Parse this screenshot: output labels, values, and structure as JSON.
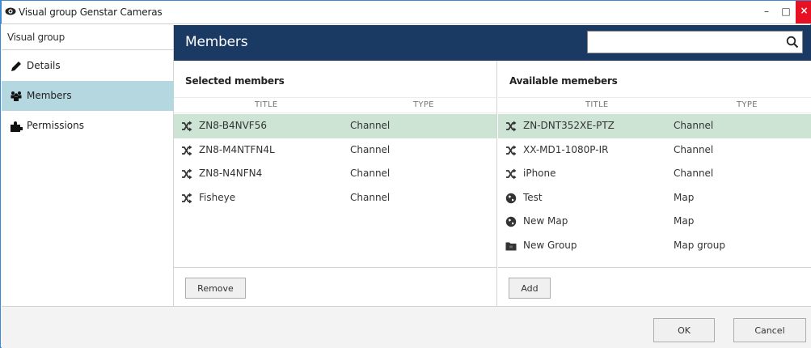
{
  "window": {
    "title": "Visual group Genstar Cameras",
    "app_icon": "eye-icon",
    "min_label": "–",
    "max_label": "□",
    "close_label": "×"
  },
  "sidebar": {
    "header": "Visual group",
    "items": [
      {
        "label": "Details",
        "icon": "pencil-icon",
        "active": false
      },
      {
        "label": "Members",
        "icon": "members-icon",
        "active": true
      },
      {
        "label": "Permissions",
        "icon": "puzzle-icon",
        "active": false
      }
    ]
  },
  "header": {
    "title": "Members",
    "search_placeholder": "",
    "search_icon": "search-icon"
  },
  "selected": {
    "title": "Selected members",
    "columns": [
      "TITLE",
      "TYPE"
    ],
    "rows": [
      {
        "title": "ZN8-B4NVF56",
        "type": "Channel",
        "icon": "shuffle-icon",
        "selected": true
      },
      {
        "title": "ZN8-M4NTFN4L",
        "type": "Channel",
        "icon": "shuffle-icon",
        "selected": false
      },
      {
        "title": "ZN8-N4NFN4",
        "type": "Channel",
        "icon": "shuffle-icon",
        "selected": false
      },
      {
        "title": "Fisheye",
        "type": "Channel",
        "icon": "shuffle-icon",
        "selected": false
      }
    ],
    "button": "Remove"
  },
  "available": {
    "title": "Available memebers",
    "columns": [
      "TITLE",
      "TYPE"
    ],
    "rows": [
      {
        "title": "ZN-DNT352XE-PTZ",
        "type": "Channel",
        "icon": "shuffle-icon",
        "selected": true
      },
      {
        "title": "XX-MD1-1080P-IR",
        "type": "Channel",
        "icon": "shuffle-icon",
        "selected": false
      },
      {
        "title": "iPhone",
        "type": "Channel",
        "icon": "shuffle-icon",
        "selected": false
      },
      {
        "title": "Test",
        "type": "Map",
        "icon": "globe-icon",
        "selected": false
      },
      {
        "title": "New Map",
        "type": "Map",
        "icon": "globe-icon",
        "selected": false
      },
      {
        "title": "New Group",
        "type": "Map group",
        "icon": "folder-icon",
        "selected": false
      }
    ],
    "button": "Add"
  },
  "footer": {
    "ok": "OK",
    "cancel": "Cancel"
  },
  "colors": {
    "header_bg": "#1b3a63",
    "active_nav": "#b5d7df",
    "selected_row": "#cde4d5",
    "close_btn": "#e81123"
  }
}
